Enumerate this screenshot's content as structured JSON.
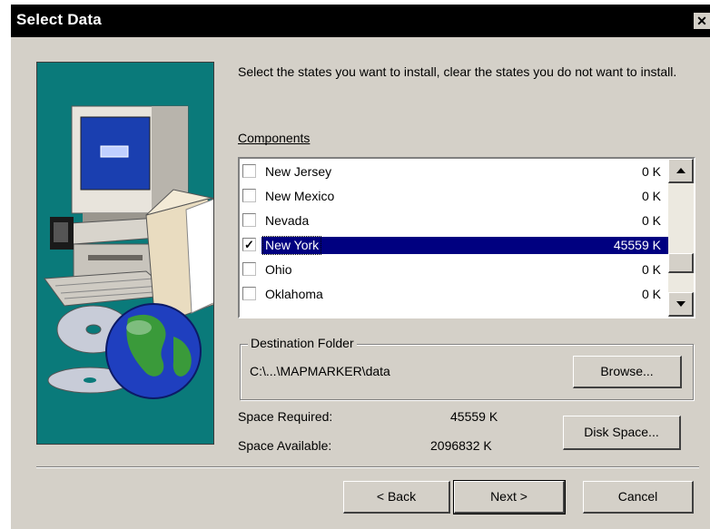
{
  "window": {
    "title": "Select Data",
    "close_glyph": "✕"
  },
  "instructions": "Select the states you want to install, clear the states you do not want to install.",
  "components": {
    "label": "Components",
    "items": [
      {
        "name": "New Jersey",
        "size": "0 K",
        "checked": false,
        "selected": false
      },
      {
        "name": "New Mexico",
        "size": "0 K",
        "checked": false,
        "selected": false
      },
      {
        "name": "Nevada",
        "size": "0 K",
        "checked": false,
        "selected": false
      },
      {
        "name": "New York",
        "size": "45559 K",
        "checked": true,
        "selected": true
      },
      {
        "name": "Ohio",
        "size": "0 K",
        "checked": false,
        "selected": false
      },
      {
        "name": "Oklahoma",
        "size": "0 K",
        "checked": false,
        "selected": false
      }
    ]
  },
  "destination": {
    "label": "Destination Folder",
    "path": "C:\\...\\MAPMARKER\\data",
    "browse_label": "Browse..."
  },
  "space": {
    "required_label": "Space Required:",
    "required_value": "45559 K",
    "available_label": "Space Available:",
    "available_value": "2096832 K",
    "disk_space_label": "Disk Space..."
  },
  "buttons": {
    "back": "< Back",
    "next": "Next >",
    "cancel": "Cancel"
  },
  "colors": {
    "teal_panel": "#0a7a7a",
    "selection": "#000080",
    "dialog_bg": "#d4d0c8"
  }
}
